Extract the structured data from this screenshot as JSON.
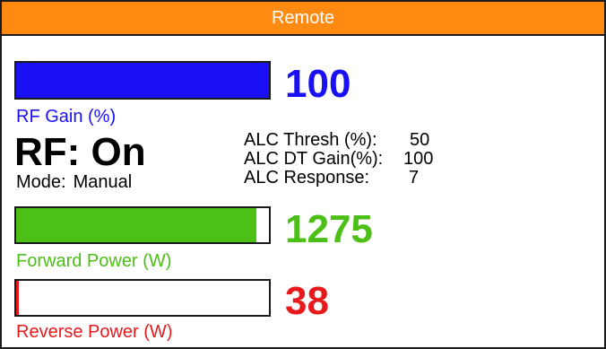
{
  "title": "Remote",
  "colors": {
    "title_bar": "#ff8a12",
    "rf_gain": "#1a10f5",
    "forward_power": "#4cc016",
    "reverse_power": "#e8191c"
  },
  "rf_gain": {
    "value": "100",
    "label": "RF Gain (%)",
    "bar_fraction": 1.0
  },
  "rf_status": {
    "text": "RF: On",
    "mode_label": "Mode:",
    "mode_value": "Manual"
  },
  "alc": [
    {
      "label": "ALC Thresh (%):",
      "value": "50"
    },
    {
      "label": "ALC DT Gain(%):",
      "value": "100"
    },
    {
      "label": "ALC Response:",
      "value": "7"
    }
  ],
  "forward_power": {
    "value": "1275",
    "label": "Forward Power (W)",
    "bar_fraction": 0.95
  },
  "reverse_power": {
    "value": "38",
    "label": "Reverse Power (W)",
    "bar_fraction": 0.01
  }
}
